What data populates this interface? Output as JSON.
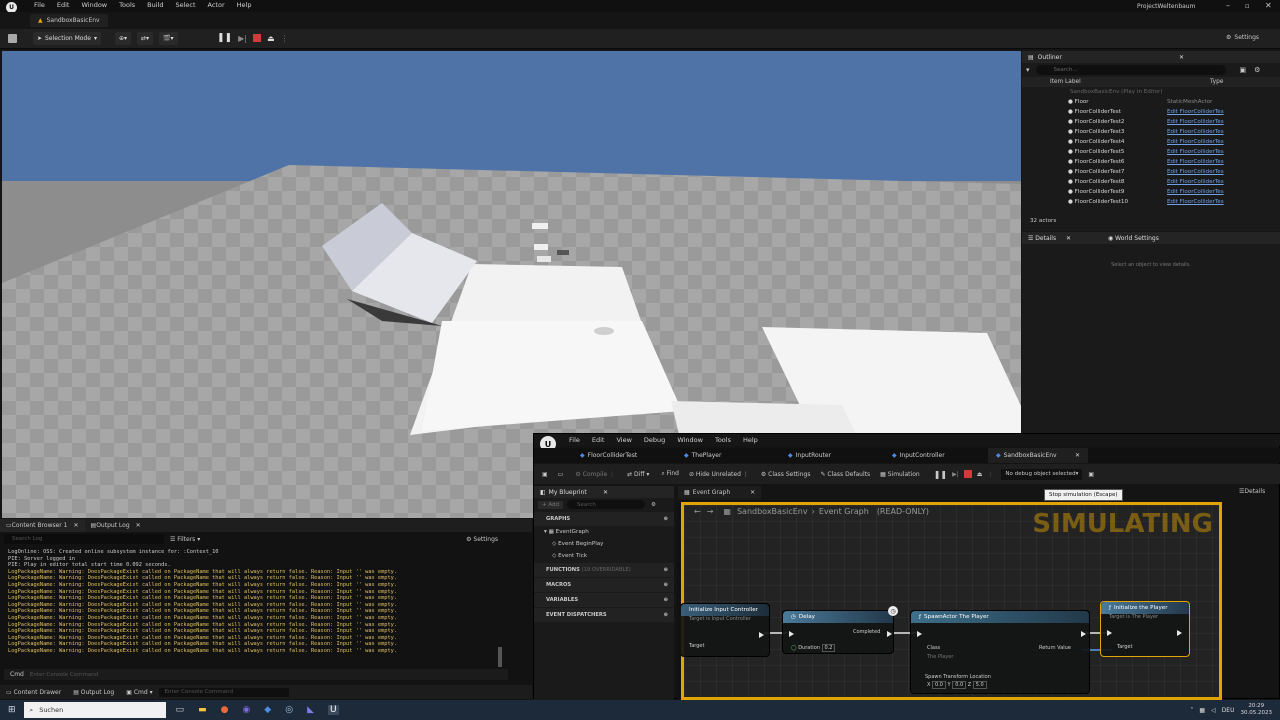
{
  "menubar": {
    "items": [
      "File",
      "Edit",
      "Window",
      "Tools",
      "Build",
      "Select",
      "Actor",
      "Help"
    ],
    "project": "ProjectWeltenbaum"
  },
  "tab": {
    "label": "SandboxBasicEnv"
  },
  "toolbar": {
    "selection_mode": "Selection Mode",
    "settings": "Settings"
  },
  "outliner": {
    "tab": "Outliner",
    "search_placeholder": "Search...",
    "col_label": "Item Label",
    "col_type": "Type",
    "root": "SandboxBasicEnv (Play In Editor)",
    "items": [
      {
        "name": "Floor",
        "type": "StaticMeshActor"
      },
      {
        "name": "FloorColliderTest",
        "type": "Edit FloorColliderTes"
      },
      {
        "name": "FloorColliderTest2",
        "type": "Edit FloorColliderTes"
      },
      {
        "name": "FloorColliderTest3",
        "type": "Edit FloorColliderTes"
      },
      {
        "name": "FloorColliderTest4",
        "type": "Edit FloorColliderTes"
      },
      {
        "name": "FloorColliderTest5",
        "type": "Edit FloorColliderTes"
      },
      {
        "name": "FloorColliderTest6",
        "type": "Edit FloorColliderTes"
      },
      {
        "name": "FloorColliderTest7",
        "type": "Edit FloorColliderTes"
      },
      {
        "name": "FloorColliderTest8",
        "type": "Edit FloorColliderTes"
      },
      {
        "name": "FloorColliderTest9",
        "type": "Edit FloorColliderTes"
      },
      {
        "name": "FloorColliderTest10",
        "type": "Edit FloorColliderTes"
      }
    ],
    "count": "32 actors"
  },
  "details": {
    "tab": "Details",
    "tab2": "World Settings",
    "empty": "Select an object to view details."
  },
  "log": {
    "tab1": "Content Browser 1",
    "tab2": "Output Log",
    "search_placeholder": "Search Log",
    "filters": "Filters",
    "settings": "Settings",
    "lines": [
      "LogOnline: OSS: Created online subsystem instance for: :Context_10",
      "PIE: Server logged in",
      "PIE: Play in editor total start time 0.092 seconds."
    ],
    "warning": "LogPackageName: Warning: DoesPackageExist called on PackageName that will always return false. Reason: Input '' was empty.",
    "cmd": "Cmd",
    "console_placeholder": "Enter Console Command"
  },
  "bottombar": {
    "content_drawer": "Content Drawer",
    "output_log": "Output Log",
    "cmd": "Cmd",
    "console_placeholder": "Enter Console Command"
  },
  "bp": {
    "menu": [
      "File",
      "Edit",
      "View",
      "Debug",
      "Window",
      "Tools",
      "Help"
    ],
    "tabs": [
      "FloorColliderTest",
      "ThePlayer",
      "InputRouter",
      "InputController",
      "SandboxBasicEnv"
    ],
    "toolbar": {
      "compile": "Compile",
      "diff": "Diff",
      "find": "Find",
      "hide": "Hide Unrelated",
      "class_settings": "Class Settings",
      "class_defaults": "Class Defaults",
      "simulation": "Simulation",
      "debug": "No debug object selected"
    },
    "tooltip": "Stop simulation (Escape)",
    "my_blueprint": "My Blueprint",
    "add": "+ Add",
    "search_placeholder": "Search",
    "sections": {
      "graphs": "GRAPHS",
      "functions": "FUNCTIONS",
      "functions_count": "(19 OVERRIDABLE)",
      "macros": "MACROS",
      "variables": "VARIABLES",
      "dispatchers": "EVENT DISPATCHERS"
    },
    "graph_items": [
      "EventGraph",
      "Event BeginPlay",
      "Event Tick"
    ],
    "graph_tab": "Event Graph",
    "details": "Details",
    "breadcrumb": "SandboxBasicEnv",
    "breadcrumb_graph": "Event Graph",
    "readonly": "(READ-ONLY)",
    "watermark": "SIMULATING",
    "nodes": {
      "n1_title": "Initialize Input Controller",
      "n1_sub": "Target is Input Controller",
      "n1_pin": "Target",
      "delay_title": "Delay",
      "delay_pin": "Duration",
      "delay_value": "0.2",
      "delay_out": "Completed",
      "spawn_title": "SpawnActor The Player",
      "spawn_class": "Class",
      "spawn_class_value": "The Player",
      "spawn_ret": "Return Value",
      "spawn_loc": "Spawn Transform Location",
      "spawn_x": "0.0",
      "spawn_y": "0.0",
      "spawn_z": "5.0",
      "init_title": "Initialize the Player",
      "init_sub": "Target is The Player",
      "init_pin": "Target"
    }
  },
  "taskbar": {
    "search_placeholder": "Suchen",
    "lang": "DEU",
    "time": "20:29",
    "date": "30.05.2023"
  },
  "colors": {
    "accent": "#e2a400",
    "link": "#6fa0e6",
    "warning": "#e0c060",
    "stop": "#d43a3a"
  }
}
